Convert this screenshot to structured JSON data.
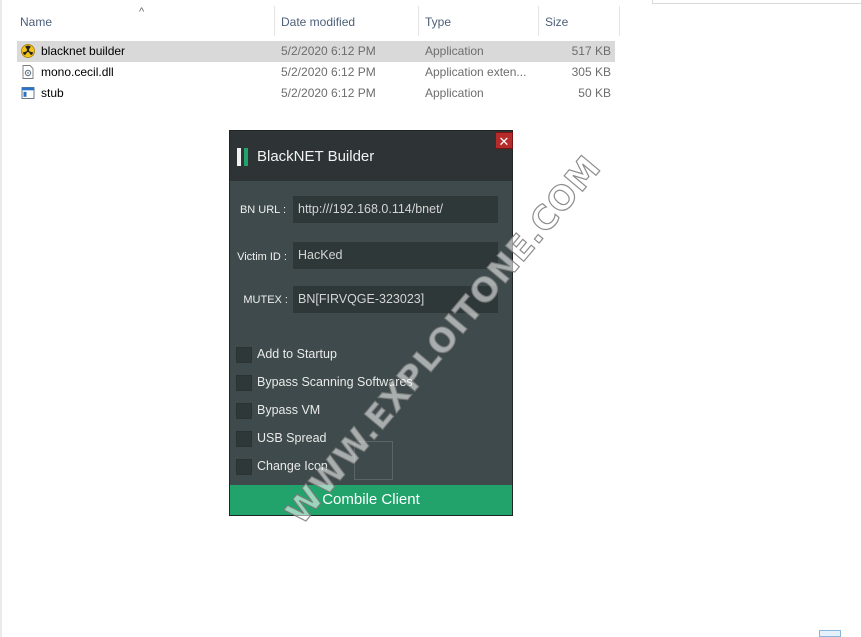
{
  "explorer": {
    "columns": {
      "name": "Name",
      "date_modified": "Date modified",
      "type": "Type",
      "size": "Size"
    },
    "files": [
      {
        "name": "blacknet builder",
        "date": "5/2/2020 6:12 PM",
        "type": "Application",
        "size": "517 KB",
        "icon": "radioactive-app-icon",
        "selected": true
      },
      {
        "name": "mono.cecil.dll",
        "date": "5/2/2020 6:12 PM",
        "type": "Application exten...",
        "size": "305 KB",
        "icon": "dll-file-icon",
        "selected": false
      },
      {
        "name": "stub",
        "date": "5/2/2020 6:12 PM",
        "type": "Application",
        "size": "50 KB",
        "icon": "app-window-icon",
        "selected": false
      }
    ]
  },
  "builder": {
    "title": "BlackNET Builder",
    "close_glyph": "✕",
    "fields": {
      "bn_url_label": "BN URL :",
      "bn_url_value": "http:///192.168.0.114/bnet/",
      "victim_id_label": "Victim ID :",
      "victim_id_value": "HacKed",
      "mutex_label": "MUTEX :",
      "mutex_value": "BN[FIRVQGE-323023]"
    },
    "options": [
      {
        "label": "Add to Startup",
        "checked": false
      },
      {
        "label": "Bypass Scanning Softwares",
        "checked": false
      },
      {
        "label": "Bypass VM",
        "checked": false
      },
      {
        "label": "USB Spread",
        "checked": false
      },
      {
        "label": "Change Icon",
        "checked": false
      }
    ],
    "combile_button": "Combile Client",
    "colors": {
      "window_bg": "#3e4a4b",
      "titlebar_bg": "#2e3435",
      "accent_green": "#21a36b",
      "logo_white": "#f2f2f2",
      "close_red": "#b52b2b"
    }
  },
  "watermark": "WWW.EXPLOITONE.COM"
}
